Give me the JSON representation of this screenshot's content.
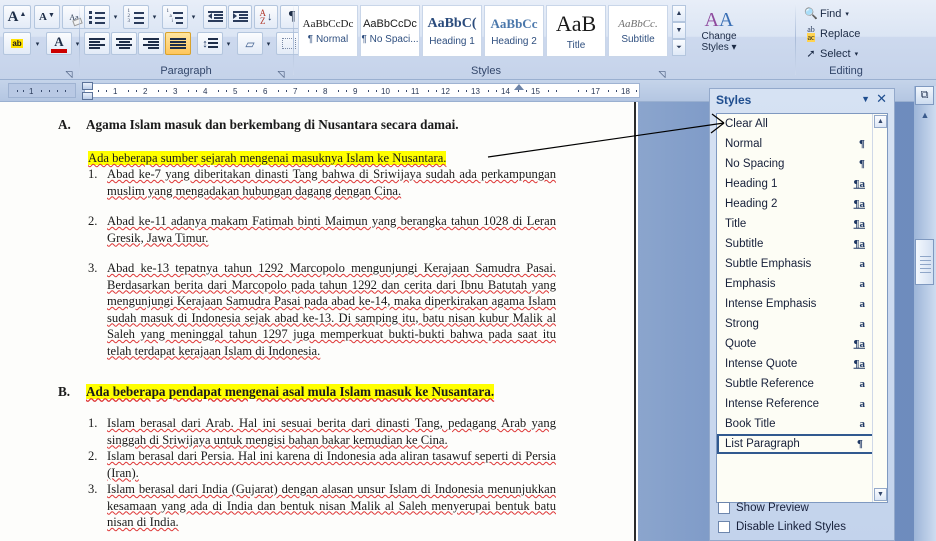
{
  "ribbon": {
    "groups": [
      {
        "label": ""
      },
      {
        "label": "Paragraph"
      },
      {
        "label": "Styles"
      },
      {
        "label": "Editing"
      }
    ],
    "font_group": {
      "grow_font": "A",
      "shrink_font": "A",
      "clear_formatting": "Aa",
      "text_highlight": "ab",
      "font_color": "A"
    },
    "paragraph_group": {
      "bullets": "Bullets",
      "numbering": "Numbering",
      "multilevel_list": "Multilevel List",
      "decrease_indent": "Decrease Indent",
      "increase_indent": "Increase Indent",
      "sort": "Sort",
      "show_marks": "¶",
      "align_left": "Align Text Left",
      "align_center": "Center",
      "align_right": "Align Text Right",
      "align_justify": "Justify",
      "line_spacing": "Line Spacing",
      "shading": "Shading",
      "borders": "Borders"
    },
    "styles_gallery": [
      {
        "preview": "AaBbCcDc",
        "name": "¶ Normal"
      },
      {
        "preview": "AaBbCcDc",
        "name": "¶ No Spaci..."
      },
      {
        "preview": "AaBbC(",
        "name": "Heading 1"
      },
      {
        "preview": "AaBbCc",
        "name": "Heading 2"
      },
      {
        "preview": "AaB",
        "name": "Title"
      },
      {
        "preview": "AaBbCc.",
        "name": "Subtitle"
      }
    ],
    "change_styles": {
      "line1": "Change",
      "line2": "Styles"
    },
    "editing": [
      {
        "icon": "binoculars-icon",
        "label": "Find",
        "caret": "▾"
      },
      {
        "icon": "replace-icon",
        "label": "Replace",
        "caret": ""
      },
      {
        "icon": "select-arrow-icon",
        "label": "Select",
        "caret": "▾"
      }
    ]
  },
  "ruler": {
    "left_ticks": [
      "1"
    ],
    "ticks": [
      "1",
      "2",
      "3",
      "4",
      "5",
      "6",
      "7",
      "8",
      "9",
      "10",
      "11",
      "12",
      "13",
      "14",
      "15",
      "17",
      "18"
    ]
  },
  "document": {
    "section_a": {
      "marker": "A.",
      "heading": "Agama Islam masuk dan berkembang di Nusantara secara damai.",
      "highlight_line": "Ada beberapa sumber sejarah mengenai masuknya Islam ke Nusantara.",
      "items": [
        {
          "num": "1.",
          "text": "Abad ke-7 yang diberitakan dinasti Tang bahwa di Sriwijaya sudah ada perkampungan muslim yang mengadakan hubungan dagang dengan Cina."
        },
        {
          "num": "2.",
          "text": "Abad ke-11 adanya makam Fatimah binti Maimun yang berangka tahun 1028 di Leran Gresik, Jawa Timur."
        },
        {
          "num": "3.",
          "text": "Abad ke-13 tepatnya tahun 1292 Marcopolo mengunjungi Kerajaan Samudra Pasai. Berdasarkan berita dari Marcopolo pada tahun 1292 dan cerita dari Ibnu Batutah yang mengunjungi Kerajaan Samudra Pasai pada abad ke-14, maka diperkirakan agama Islam sudah masuk di Indonesia sejak abad ke-13. Di samping itu, batu nisan kubur Malik al Saleh yang meninggal tahun 1297 juga memperkuat bukti-bukti bahwa pada saat itu telah terdapat kerajaan Islam di Indonesia."
        }
      ]
    },
    "section_b": {
      "marker": "B.",
      "heading": "Ada beberapa pendapat mengenai asal mula Islam masuk ke Nusantara.",
      "items": [
        {
          "num": "1.",
          "text": "Islam berasal dari Arab. Hal ini sesuai berita dari dinasti Tang, pedagang Arab yang singgah di Sriwijaya untuk mengisi bahan bakar kemudian ke Cina."
        },
        {
          "num": "2.",
          "text": "Islam berasal dari Persia. Hal ini karena di Indonesia ada aliran tasawuf seperti di Persia (Iran)."
        },
        {
          "num": "3.",
          "text": "Islam berasal dari India (Gujarat) dengan alasan unsur Islam di Indonesia menunjukkan kesamaan yang ada di India dan bentuk nisan Malik al Saleh menyerupai bentuk batu nisan di India."
        }
      ]
    }
  },
  "styles_pane": {
    "title": "Styles",
    "dropdown_icon": "▼",
    "close_icon": "✕",
    "items": [
      {
        "label": "Clear All",
        "icon": ""
      },
      {
        "label": "Normal",
        "icon": "¶",
        "kind": "paragraph"
      },
      {
        "label": "No Spacing",
        "icon": "¶",
        "kind": "paragraph"
      },
      {
        "label": "Heading 1",
        "icon": "¶a",
        "kind": "linked"
      },
      {
        "label": "Heading 2",
        "icon": "¶a",
        "kind": "linked"
      },
      {
        "label": "Title",
        "icon": "¶a",
        "kind": "linked"
      },
      {
        "label": "Subtitle",
        "icon": "¶a",
        "kind": "linked"
      },
      {
        "label": "Subtle Emphasis",
        "icon": "a",
        "kind": "character"
      },
      {
        "label": "Emphasis",
        "icon": "a",
        "kind": "character"
      },
      {
        "label": "Intense Emphasis",
        "icon": "a",
        "kind": "character"
      },
      {
        "label": "Strong",
        "icon": "a",
        "kind": "character"
      },
      {
        "label": "Quote",
        "icon": "¶a",
        "kind": "linked"
      },
      {
        "label": "Intense Quote",
        "icon": "¶a",
        "kind": "linked"
      },
      {
        "label": "Subtle Reference",
        "icon": "a",
        "kind": "character"
      },
      {
        "label": "Intense Reference",
        "icon": "a",
        "kind": "character"
      },
      {
        "label": "Book Title",
        "icon": "a",
        "kind": "character"
      },
      {
        "label": "List Paragraph",
        "icon": "¶",
        "kind": "paragraph",
        "selected": true
      }
    ],
    "scroll_up": "▲",
    "scroll_down": "▼",
    "checkboxes": [
      {
        "label": "Show Preview",
        "checked": false
      },
      {
        "label": "Disable Linked Styles",
        "checked": false
      }
    ]
  },
  "window_scrollbar": {
    "corner_icon": "⧉",
    "up_arrow": "▲"
  },
  "colors": {
    "highlight": "#ffff00",
    "pane_title": "#1f4e8f",
    "ribbon_label": "#33476b",
    "selection_border": "#31598f",
    "spell_underline": "#dd3333"
  }
}
